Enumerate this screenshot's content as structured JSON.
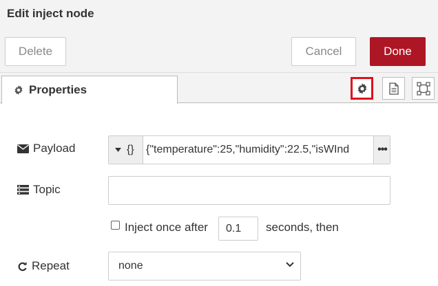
{
  "title": "Edit inject node",
  "buttons": {
    "delete": "Delete",
    "cancel": "Cancel",
    "done": "Done"
  },
  "tabs": {
    "properties": "Properties"
  },
  "icons": {
    "properties_tab": "gear-icon",
    "node_settings": "gear-icon",
    "description": "document-icon",
    "appearance": "frame-icon",
    "payload": "envelope-icon",
    "topic": "list-icon",
    "repeat": "repeat-icon"
  },
  "colors": {
    "done_button": "#ad1625",
    "highlight": "#e0101b",
    "panel_bg": "#f3f3f3"
  },
  "form": {
    "payload": {
      "label": "Payload",
      "type_symbol": "{}",
      "value": "{\"temperature\":25,\"humidity\":22.5,\"isWInd",
      "expand_label": "•••"
    },
    "topic": {
      "label": "Topic",
      "value": ""
    },
    "inject_once": {
      "label": "Inject once after",
      "checked": false,
      "value": "0.1",
      "suffix": "seconds, then"
    },
    "repeat": {
      "label": "Repeat",
      "selected": "none"
    }
  }
}
